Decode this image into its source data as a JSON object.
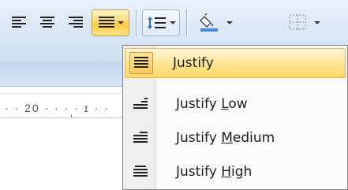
{
  "toolbar": {
    "buttons": [
      {
        "name": "align-left",
        "icon": "align-left-icon"
      },
      {
        "name": "align-center",
        "icon": "align-center-icon"
      },
      {
        "name": "align-right",
        "icon": "align-right-icon"
      },
      {
        "name": "justify",
        "icon": "justify-icon",
        "active": true
      },
      {
        "name": "line-spacing",
        "icon": "line-spacing-icon"
      },
      {
        "name": "shading",
        "icon": "shading-bucket-icon"
      },
      {
        "name": "borders",
        "icon": "borders-icon"
      }
    ]
  },
  "ruler": {
    "label": "· · 20 · · · · ɪ · ·"
  },
  "menu": {
    "items": [
      {
        "label": "Justify",
        "accel_index": 0,
        "selected": true,
        "icon": "justify-icon"
      },
      {
        "label": "Justify Low",
        "accel_index": 8,
        "selected": false,
        "icon": "justify-low-icon"
      },
      {
        "label": "Justify Medium",
        "accel_index": 8,
        "selected": false,
        "icon": "justify-medium-icon"
      },
      {
        "label": "Justify High",
        "accel_index": 8,
        "selected": false,
        "icon": "justify-high-icon"
      }
    ]
  },
  "colors": {
    "active_highlight": "#ffd86b",
    "toolbar_bg": "#dce8f6",
    "menu_bg": "#fafafa"
  }
}
